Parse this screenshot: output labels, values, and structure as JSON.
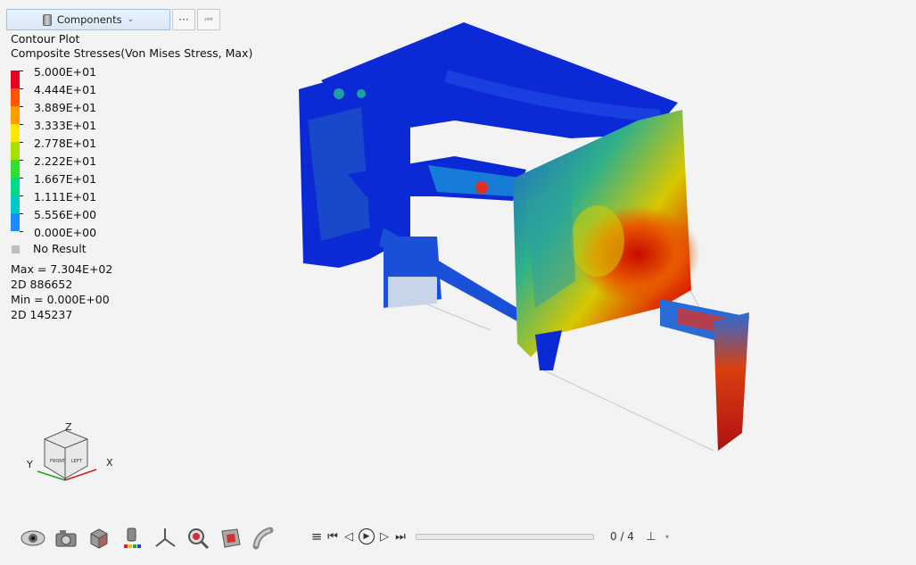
{
  "components_button": {
    "label": "Components",
    "menu_label": "···",
    "skip_label": "⏮"
  },
  "legend": {
    "title": "Contour Plot",
    "subtitle": "Composite Stresses(Von Mises Stress, Max)",
    "levels": [
      "5.000E+01",
      "4.444E+01",
      "3.889E+01",
      "3.333E+01",
      "2.778E+01",
      "2.222E+01",
      "1.667E+01",
      "1.111E+01",
      "5.556E+00",
      "0.000E+00"
    ],
    "colors": [
      "#e8001e",
      "#ff5500",
      "#ff9d00",
      "#ffe800",
      "#a8e000",
      "#2fe02f",
      "#00d88a",
      "#00c8c8",
      "#1a8cff",
      "#0b2ad6"
    ],
    "no_result": "No Result",
    "no_result_color": "#bdbdbd",
    "max_line": "Max =  7.304E+02",
    "max_elem": "2D 886652",
    "min_line": "Min =  0.000E+00",
    "min_elem": "2D 145237"
  },
  "triad": {
    "z": "Z",
    "y": "Y",
    "x": "X",
    "front": "FRONT",
    "left": "LEFT"
  },
  "toolbar": {
    "icons": [
      "eye-icon",
      "camera-icon",
      "cube-icon",
      "contour-legend-icon",
      "axes-icon",
      "zoom-search-icon",
      "section-cut-icon",
      "pipe-icon"
    ]
  },
  "player": {
    "frame": "0 / 4"
  }
}
